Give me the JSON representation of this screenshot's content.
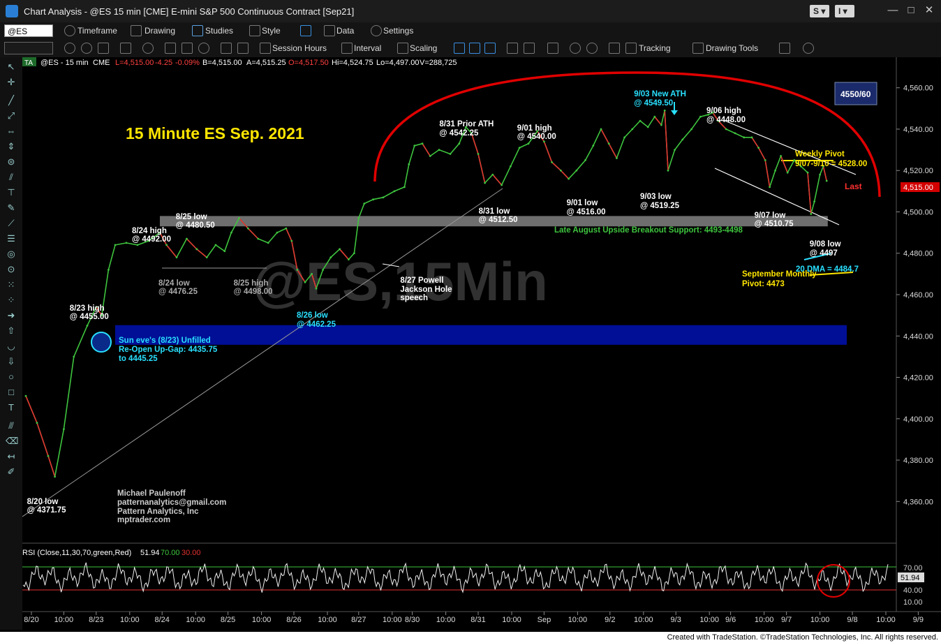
{
  "window": {
    "title": "Chart Analysis - @ES 15 min [CME] E-mini S&P 500 Continuous Contract [Sep21]",
    "s_button": "S",
    "i_button": "I",
    "minimize": "—",
    "maximize": "□",
    "close": "✕"
  },
  "toolbar1": {
    "symbol_value": "@ES",
    "timeframe": "Timeframe",
    "drawing": "Drawing",
    "studies": "Studies",
    "style": "Style",
    "data": "Data",
    "settings": "Settings"
  },
  "toolbar2": {
    "session_hours": "Session Hours",
    "interval": "Interval",
    "scaling": "Scaling",
    "tracking": "Tracking",
    "drawing_tools": "Drawing Tools"
  },
  "status_bar": {
    "badge": "TA",
    "symbol": "@ES - 15 min",
    "exchange": "CME",
    "last": "L=4,515.00",
    "change": "-4.25",
    "pct_change": "-0.09%",
    "bid": "B=4,515.00",
    "ask": "A=4,515.25",
    "open": "O=4,517.50",
    "high": "Hi=4,524.75",
    "low": "Lo=4,497.00",
    "volume": "V=288,725"
  },
  "colors": {
    "price_line": "#3ec43e",
    "down_color": "#e23030",
    "resistance_arc": "#e00000",
    "gap_zone": "#000f96",
    "support_zone": "#8a8a8a",
    "cyan": "#29e0ff",
    "yellow": "#ffe600",
    "price_badge": "#d40000"
  },
  "chart_data": {
    "type": "line",
    "title": "15 Minute ES Sep. 2021",
    "watermark": "@ES,15Min",
    "xlabel": "",
    "ylabel": "",
    "ylim": [
      4350,
      4575
    ],
    "y_ticks": [
      4360,
      4380,
      4400,
      4420,
      4440,
      4460,
      4480,
      4500,
      4520,
      4540,
      4560
    ],
    "y_tick_labels": [
      "4,360.00",
      "4,380.00",
      "4,400.00",
      "4,420.00",
      "4,440.00",
      "4,460.00",
      "4,480.00",
      "4,500.00",
      "4,520.00",
      "4,540.00",
      "4,560.00"
    ],
    "x_labels": [
      "8/20",
      "10:00",
      "8/23",
      "10:00",
      "8/24",
      "10:00",
      "8/25",
      "10:00",
      "8/26",
      "10:00",
      "8/27",
      "10:00",
      "8/30",
      "10:00",
      "8/31",
      "10:00",
      "Sep",
      "10:00",
      "9/2",
      "10:00",
      "9/3",
      "10:00",
      "9/6",
      "10:00",
      "9/7",
      "10:00",
      "9/8",
      "10:00",
      "9/9"
    ],
    "x_label_pos": [
      0.5,
      3.4,
      6.3,
      9.3,
      12.2,
      15.2,
      18.1,
      21.1,
      24,
      27,
      29.8,
      32.8,
      34.6,
      37.6,
      40.5,
      43.5,
      46.4,
      49.4,
      52.3,
      55.3,
      58.2,
      61.2,
      63.1,
      66.1,
      68.1,
      71.1,
      74,
      77,
      79.9
    ],
    "last_price": "4,515.00",
    "last_label": "Last",
    "target_box": "4550/60",
    "series": [
      {
        "values": [
          {
            "x": 0,
            "y": 4411
          },
          {
            "x": 1,
            "y": 4398
          },
          {
            "x": 2,
            "y": 4382
          },
          {
            "x": 2.6,
            "y": 4372
          },
          {
            "x": 3.4,
            "y": 4395
          },
          {
            "x": 4.3,
            "y": 4430
          },
          {
            "x": 5.5,
            "y": 4445
          },
          {
            "x": 6.3,
            "y": 4454
          },
          {
            "x": 6.8,
            "y": 4450
          },
          {
            "x": 7.4,
            "y": 4472
          },
          {
            "x": 8,
            "y": 4484
          },
          {
            "x": 9,
            "y": 4485
          },
          {
            "x": 10,
            "y": 4484
          },
          {
            "x": 11,
            "y": 4486
          },
          {
            "x": 12,
            "y": 4490
          },
          {
            "x": 12.6,
            "y": 4484
          },
          {
            "x": 13.5,
            "y": 4478
          },
          {
            "x": 14.4,
            "y": 4487
          },
          {
            "x": 15.3,
            "y": 4482
          },
          {
            "x": 16.2,
            "y": 4478
          },
          {
            "x": 17,
            "y": 4484
          },
          {
            "x": 17.8,
            "y": 4481
          },
          {
            "x": 18.4,
            "y": 4490
          },
          {
            "x": 19.1,
            "y": 4497
          },
          {
            "x": 19.9,
            "y": 4492
          },
          {
            "x": 20.8,
            "y": 4487
          },
          {
            "x": 21.7,
            "y": 4485
          },
          {
            "x": 22.5,
            "y": 4490
          },
          {
            "x": 23.3,
            "y": 4492
          },
          {
            "x": 23.8,
            "y": 4486
          },
          {
            "x": 24.3,
            "y": 4472
          },
          {
            "x": 25,
            "y": 4466
          },
          {
            "x": 25.6,
            "y": 4470
          },
          {
            "x": 26,
            "y": 4463
          },
          {
            "x": 26.6,
            "y": 4472
          },
          {
            "x": 27.3,
            "y": 4478
          },
          {
            "x": 28.1,
            "y": 4482
          },
          {
            "x": 28.9,
            "y": 4477
          },
          {
            "x": 29.4,
            "y": 4480
          },
          {
            "x": 29.8,
            "y": 4497
          },
          {
            "x": 30.3,
            "y": 4504
          },
          {
            "x": 31.1,
            "y": 4506
          },
          {
            "x": 32,
            "y": 4507
          },
          {
            "x": 33,
            "y": 4510
          },
          {
            "x": 33.9,
            "y": 4512
          },
          {
            "x": 34.3,
            "y": 4523
          },
          {
            "x": 34.8,
            "y": 4532
          },
          {
            "x": 35.5,
            "y": 4533
          },
          {
            "x": 36.2,
            "y": 4527
          },
          {
            "x": 37,
            "y": 4530
          },
          {
            "x": 38,
            "y": 4528
          },
          {
            "x": 38.8,
            "y": 4533
          },
          {
            "x": 39.4,
            "y": 4541
          },
          {
            "x": 39.9,
            "y": 4538
          },
          {
            "x": 40.5,
            "y": 4528
          },
          {
            "x": 41.1,
            "y": 4514
          },
          {
            "x": 41.8,
            "y": 4518
          },
          {
            "x": 42.6,
            "y": 4513
          },
          {
            "x": 43.4,
            "y": 4522
          },
          {
            "x": 44.2,
            "y": 4531
          },
          {
            "x": 45,
            "y": 4533
          },
          {
            "x": 45.8,
            "y": 4539
          },
          {
            "x": 46.4,
            "y": 4534
          },
          {
            "x": 47.1,
            "y": 4524
          },
          {
            "x": 47.9,
            "y": 4520
          },
          {
            "x": 48.6,
            "y": 4516
          },
          {
            "x": 49.3,
            "y": 4520
          },
          {
            "x": 50.1,
            "y": 4525
          },
          {
            "x": 50.8,
            "y": 4532
          },
          {
            "x": 51.5,
            "y": 4540
          },
          {
            "x": 52.2,
            "y": 4533
          },
          {
            "x": 52.9,
            "y": 4526
          },
          {
            "x": 53.6,
            "y": 4536
          },
          {
            "x": 54.3,
            "y": 4540
          },
          {
            "x": 55,
            "y": 4544
          },
          {
            "x": 55.7,
            "y": 4541
          },
          {
            "x": 56.3,
            "y": 4546
          },
          {
            "x": 56.9,
            "y": 4542
          },
          {
            "x": 57.2,
            "y": 4549
          },
          {
            "x": 57.5,
            "y": 4520
          },
          {
            "x": 58.1,
            "y": 4530
          },
          {
            "x": 58.8,
            "y": 4535
          },
          {
            "x": 59.6,
            "y": 4540
          },
          {
            "x": 60.4,
            "y": 4546
          },
          {
            "x": 61.1,
            "y": 4547
          },
          {
            "x": 61.5,
            "y": 4548
          },
          {
            "x": 62,
            "y": 4544
          },
          {
            "x": 62.7,
            "y": 4540
          },
          {
            "x": 63.5,
            "y": 4538
          },
          {
            "x": 64.3,
            "y": 4536
          },
          {
            "x": 65,
            "y": 4536
          },
          {
            "x": 65.6,
            "y": 4531
          },
          {
            "x": 66.2,
            "y": 4525
          },
          {
            "x": 66.6,
            "y": 4512
          },
          {
            "x": 67.1,
            "y": 4520
          },
          {
            "x": 67.6,
            "y": 4527
          },
          {
            "x": 68.2,
            "y": 4519
          },
          {
            "x": 68.8,
            "y": 4525
          },
          {
            "x": 69.4,
            "y": 4522
          },
          {
            "x": 70,
            "y": 4519
          },
          {
            "x": 70.3,
            "y": 4499
          },
          {
            "x": 70.6,
            "y": 4505
          },
          {
            "x": 71.1,
            "y": 4518
          },
          {
            "x": 71.4,
            "y": 4522
          },
          {
            "x": 71.7,
            "y": 4515
          }
        ]
      }
    ],
    "annotations": [
      {
        "text": "8/20 low",
        "x": 2.6,
        "y": 4371.75
      },
      {
        "text": "@ 4371.75",
        "x": 2.6,
        "y": 4371.75
      },
      {
        "text": "8/23 high",
        "x": 6.3,
        "y": 4455
      },
      {
        "text": "@ 4455.00",
        "x": 6.3,
        "y": 4455
      },
      {
        "text": "8/24 high",
        "x": 12,
        "y": 4492
      },
      {
        "text": "@ 4492.00",
        "x": 12,
        "y": 4492
      },
      {
        "text": "8/24 low",
        "x": 13.5,
        "y": 4476.25
      },
      {
        "text": "@ 4476.25",
        "x": 13.5,
        "y": 4476.25
      },
      {
        "text": "8/25 high",
        "x": 19.1,
        "y": 4498
      },
      {
        "text": "@ 4498.00",
        "x": 19.1,
        "y": 4498
      },
      {
        "text": "8/25 low",
        "x": 17.8,
        "y": 4480.5
      },
      {
        "text": "@ 4480.50",
        "x": 17.8,
        "y": 4480.5
      },
      {
        "text": "8/26 low",
        "x": 26,
        "y": 4462.25
      },
      {
        "text": "@ 4462.25",
        "x": 26,
        "y": 4462.25
      },
      {
        "text": "8/27 Powell",
        "x": 29.4,
        "y": 4477
      },
      {
        "text": "Jackson Hole",
        "x": 29.4,
        "y": 4477
      },
      {
        "text": "speech",
        "x": 29.4,
        "y": 4477
      },
      {
        "text": "8/31 Prior ATH",
        "x": 39.4,
        "y": 4542.25
      },
      {
        "text": "@ 4542.25",
        "x": 39.4,
        "y": 4542.25
      },
      {
        "text": "8/31 low",
        "x": 41.1,
        "y": 4512.5
      },
      {
        "text": "@ 4512.50",
        "x": 41.1,
        "y": 4512.5
      },
      {
        "text": "9/01 high",
        "x": 45.8,
        "y": 4540
      },
      {
        "text": "@ 4540.00",
        "x": 45.8,
        "y": 4540
      },
      {
        "text": "9/01 low",
        "x": 48.6,
        "y": 4516
      },
      {
        "text": "@ 4516.00",
        "x": 48.6,
        "y": 4516
      },
      {
        "text": "9/03 New ATH",
        "x": 57.2,
        "y": 4549.5
      },
      {
        "text": "@ 4549.50",
        "x": 57.2,
        "y": 4549.5
      },
      {
        "text": "9/03 low",
        "x": 57.5,
        "y": 4519.25
      },
      {
        "text": "@ 4519.25",
        "x": 57.5,
        "y": 4519.25
      },
      {
        "text": "9/06 high",
        "x": 61.5,
        "y": 4548
      },
      {
        "text": "@ 4448.00",
        "x": 61.5,
        "y": 4548
      },
      {
        "text": "Weekly Pivot",
        "x": 68.5,
        "y": 4528
      },
      {
        "text": "9/07-9/10 = 4528.00",
        "x": 68.5,
        "y": 4528
      },
      {
        "text": "9/07 low",
        "x": 66.6,
        "y": 4510.75
      },
      {
        "text": "@ 4510.75",
        "x": 66.6,
        "y": 4510.75
      },
      {
        "text": "9/08 low",
        "x": 70.3,
        "y": 4497
      },
      {
        "text": "@ 4497",
        "x": 70.3,
        "y": 4497
      },
      {
        "text": "20 DMA = 4484.7",
        "x": 70,
        "y": 4484.7
      },
      {
        "text": "September Monthly",
        "x": 70,
        "y": 4473
      },
      {
        "text": "Pivot: 4473",
        "x": 70,
        "y": 4473
      },
      {
        "text": "Late August Upside Breakout Support: 4493-4498",
        "x": 47,
        "y": 4495.5
      },
      {
        "text": "Sun eve's (8/23) Unfilled",
        "x": 7.5,
        "y": 4440
      },
      {
        "text": "Re-Open Up-Gap: 4435.75",
        "x": 7.5,
        "y": 4440
      },
      {
        "text": "to 4445.25",
        "x": 7.5,
        "y": 4440
      },
      {
        "text": "Michael Paulenoff",
        "x": 10,
        "y": 4370
      },
      {
        "text": "patternanalytics@gmail.com",
        "x": 10,
        "y": 4370
      },
      {
        "text": "Pattern Analytics, Inc",
        "x": 10,
        "y": 4370
      },
      {
        "text": "mptrader.com",
        "x": 10,
        "y": 4370
      }
    ],
    "zones": [
      {
        "name": "breakout_support",
        "from": 4493,
        "to": 4498
      },
      {
        "name": "gap",
        "from": 4435.75,
        "to": 4445.25
      }
    ]
  },
  "rsi": {
    "label": "RSI (Close,11,30,70,green,Red)",
    "value": "51.94",
    "overbought": "70.00",
    "oversold": "30.00",
    "y_ticks": [
      "70.00",
      "40.00",
      "10.00"
    ],
    "current": "51.94"
  },
  "footer": {
    "text": "Created with TradeStation. ©TradeStation Technologies, Inc. All rights reserved."
  }
}
